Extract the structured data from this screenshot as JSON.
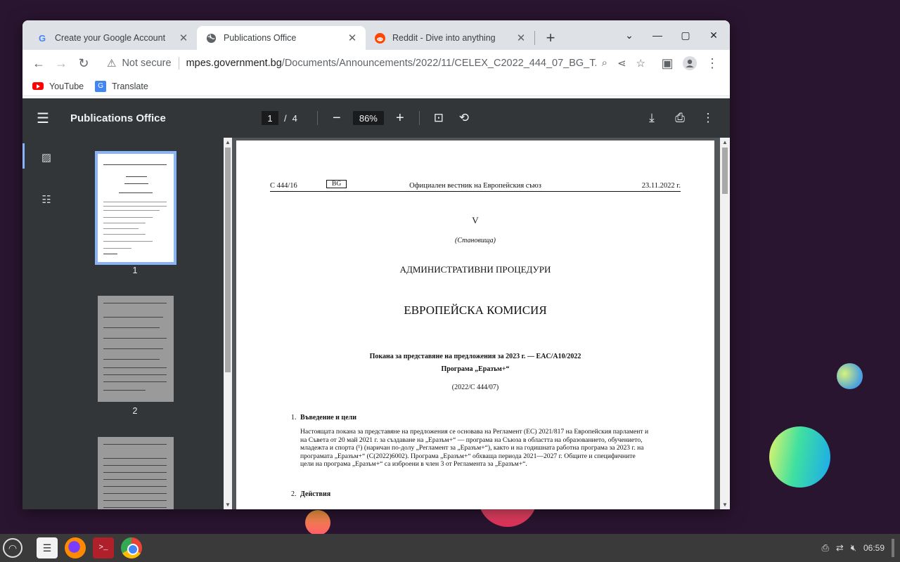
{
  "browser": {
    "tabs": [
      {
        "title": "Create your Google Account",
        "favicon": "google-icon",
        "active": false
      },
      {
        "title": "Publications Office",
        "favicon": "globe-icon",
        "active": true
      },
      {
        "title": "Reddit - Dive into anything",
        "favicon": "reddit-icon",
        "active": false
      }
    ],
    "new_tab_label": "+",
    "omnibox": {
      "security_label": "Not secure",
      "url_domain": "mpes.government.bg",
      "url_path": "/Documents/Announcements/2022/11/CELEX_C2022_444_07_BG_T..."
    },
    "bookmarks": [
      {
        "label": "YouTube",
        "icon": "youtube-icon"
      },
      {
        "label": "Translate",
        "icon": "translate-icon"
      }
    ]
  },
  "pdf_viewer": {
    "title": "Publications Office",
    "current_page": "1",
    "page_separator": "/",
    "total_pages": "4",
    "zoom": "86%",
    "thumbnails": [
      {
        "label": "1"
      },
      {
        "label": "2"
      }
    ]
  },
  "document": {
    "header_left": "C 444/16",
    "header_lang": "BG",
    "header_center": "Официален вестник на Европейския съюз",
    "header_right": "23.11.2022 г.",
    "section_numeral": "V",
    "section_subtitle": "(Становища)",
    "heading1": "АДМИНИСТРАТИВНИ ПРОЦЕДУРИ",
    "heading2": "ЕВРОПЕЙСКА КОМИСИЯ",
    "call_title": "Покана за представяне на предложения за 2023 г. — EAC/A10/2022",
    "programme": "Програма „Еразъм+“",
    "reference": "(2022/C 444/07)",
    "sections": [
      {
        "number": "1.",
        "title": "Въведение и цели",
        "lines": [
          "Настоящата покана за представяне на предложения се основава на Регламент (ЕС) 2021/817 на Европейския парламент и",
          "на Съвета от 20 май 2021 г. за създаване на „Еразъм+“ — програма на Съюза в областта на образованието, обучението,",
          "младежта и спорта (¹) (наричан по-долу „Регламент за „Еразъм+“), както и на годишната работна програма за 2023 г. на",
          "програмата „Еразъм+“ (C(2022)6002). Програма „Еразъм+“ обхваща периода 2021—2027 г. Общите и специфичните",
          "цели на програма „Еразъм+“ са изброени в член 3 от Регламента за „Еразъм+“."
        ]
      },
      {
        "number": "2.",
        "title": "Действия",
        "lines": []
      }
    ]
  },
  "taskbar": {
    "clock": "06:59"
  }
}
